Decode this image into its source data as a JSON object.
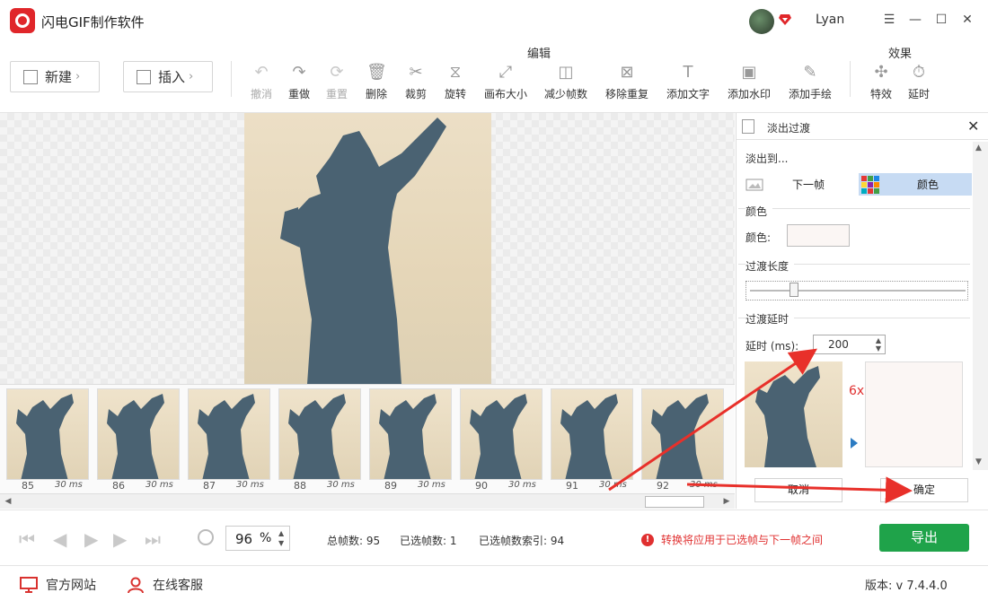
{
  "app": {
    "title": "闪电GIF制作软件",
    "username": "Lyan",
    "window_controls": [
      "menu-icon",
      "minimize-icon",
      "maximize-icon",
      "close-icon"
    ]
  },
  "toolbar": {
    "new_label": "新建",
    "insert_label": "插入",
    "edit_group_label": "编辑",
    "effects_group_label": "效果",
    "tools": [
      {
        "label": "撤消",
        "icon": "undo-icon",
        "enabled": false
      },
      {
        "label": "重做",
        "icon": "redo-icon",
        "enabled": true
      },
      {
        "label": "重置",
        "icon": "reset-icon",
        "enabled": false
      },
      {
        "label": "删除",
        "icon": "trash-icon",
        "enabled": true
      },
      {
        "label": "裁剪",
        "icon": "scissors-icon",
        "enabled": true
      },
      {
        "label": "旋转",
        "icon": "rotate-icon",
        "enabled": true
      },
      {
        "label": "画布大小",
        "icon": "canvas-size-icon",
        "enabled": true
      },
      {
        "label": "减少帧数",
        "icon": "reduce-frames-icon",
        "enabled": true
      },
      {
        "label": "移除重复",
        "icon": "remove-duplicates-icon",
        "enabled": true
      },
      {
        "label": "添加文字",
        "icon": "text-icon",
        "enabled": true
      },
      {
        "label": "添加水印",
        "icon": "watermark-icon",
        "enabled": true
      },
      {
        "label": "添加手绘",
        "icon": "pencil-icon",
        "enabled": true
      },
      {
        "label": "特效",
        "icon": "effects-icon",
        "enabled": true
      },
      {
        "label": "延时",
        "icon": "timer-icon",
        "enabled": true
      }
    ]
  },
  "filmstrip": {
    "frames": [
      {
        "number": "85",
        "duration": "30 ms"
      },
      {
        "number": "86",
        "duration": "30 ms"
      },
      {
        "number": "87",
        "duration": "30 ms"
      },
      {
        "number": "88",
        "duration": "30 ms"
      },
      {
        "number": "89",
        "duration": "30 ms"
      },
      {
        "number": "90",
        "duration": "30 ms"
      },
      {
        "number": "91",
        "duration": "30 ms"
      },
      {
        "number": "92",
        "duration": "30 ms"
      }
    ]
  },
  "panel": {
    "title": "淡出过渡",
    "fade_to_label": "淡出到...",
    "option_next_frame": "下一帧",
    "option_color": "颜色",
    "selected_option": "颜色",
    "color_section": "颜色",
    "color_field_label": "颜色:",
    "color_value": "#fbf6f4",
    "transition_length_section": "过渡长度",
    "transition_delay_section": "过渡延时",
    "delay_label": "延时 (ms):",
    "delay_value": "200",
    "speed_label": "6x",
    "cancel_label": "取消",
    "ok_label": "确定"
  },
  "status": {
    "zoom_value": "96",
    "zoom_unit": "%",
    "total_frames": "总帧数: 95",
    "selected_frames": "已选帧数: 1",
    "selected_index": "已选帧数索引: 94",
    "warning": "转换将应用于已选帧与下一帧之间",
    "export_label": "导出"
  },
  "footer": {
    "website_label": "官方网站",
    "support_label": "在线客服",
    "version": "版本:  v 7.4.4.0"
  },
  "colors": {
    "brand_red": "#e0262a",
    "export_green": "#1fa34a",
    "warning_red": "#e03030",
    "selected_option_bg": "#c7dbf3"
  }
}
